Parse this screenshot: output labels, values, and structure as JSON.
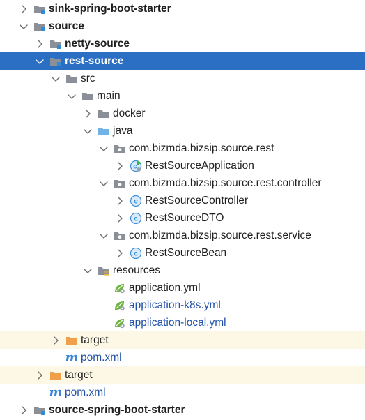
{
  "tree": {
    "items": [
      {
        "label": "sink-spring-boot-starter",
        "depth": 0,
        "state": "collapsed",
        "icon": "module-folder-icon",
        "bold": true
      },
      {
        "label": "source",
        "depth": 0,
        "state": "expanded",
        "icon": "module-folder-icon",
        "bold": true
      },
      {
        "label": "netty-source",
        "depth": 1,
        "state": "collapsed",
        "icon": "module-folder-icon",
        "bold": true
      },
      {
        "label": "rest-source",
        "depth": 1,
        "state": "expanded",
        "icon": "module-folder-icon",
        "bold": true,
        "selected": true
      },
      {
        "label": "src",
        "depth": 2,
        "state": "expanded",
        "icon": "folder-icon"
      },
      {
        "label": "main",
        "depth": 3,
        "state": "expanded",
        "icon": "folder-icon"
      },
      {
        "label": "docker",
        "depth": 4,
        "state": "collapsed",
        "icon": "folder-icon"
      },
      {
        "label": "java",
        "depth": 4,
        "state": "expanded",
        "icon": "source-root-folder-icon"
      },
      {
        "label": "com.bizmda.bizsip.source.rest",
        "depth": 5,
        "state": "expanded",
        "icon": "package-icon"
      },
      {
        "label": "RestSourceApplication",
        "depth": 6,
        "state": "collapsed",
        "icon": "spring-boot-class-icon"
      },
      {
        "label": "com.bizmda.bizsip.source.rest.controller",
        "depth": 5,
        "state": "expanded",
        "icon": "package-icon"
      },
      {
        "label": "RestSourceController",
        "depth": 6,
        "state": "collapsed",
        "icon": "class-icon"
      },
      {
        "label": "RestSourceDTO",
        "depth": 6,
        "state": "collapsed",
        "icon": "class-icon"
      },
      {
        "label": "com.bizmda.bizsip.source.rest.service",
        "depth": 5,
        "state": "expanded",
        "icon": "package-icon"
      },
      {
        "label": "RestSourceBean",
        "depth": 6,
        "state": "collapsed",
        "icon": "class-icon"
      },
      {
        "label": "resources",
        "depth": 4,
        "state": "expanded",
        "icon": "resources-folder-icon"
      },
      {
        "label": "application.yml",
        "depth": 5,
        "state": "leaf",
        "icon": "spring-config-icon"
      },
      {
        "label": "application-k8s.yml",
        "depth": 5,
        "state": "leaf",
        "icon": "spring-config-icon",
        "link": true
      },
      {
        "label": "application-local.yml",
        "depth": 5,
        "state": "leaf",
        "icon": "spring-config-icon",
        "link": true
      },
      {
        "label": "target",
        "depth": 2,
        "state": "collapsed",
        "icon": "excluded-folder-icon",
        "excluded": true
      },
      {
        "label": "pom.xml",
        "depth": 2,
        "state": "leaf",
        "icon": "maven-icon",
        "link": true
      },
      {
        "label": "target",
        "depth": 1,
        "state": "collapsed",
        "icon": "excluded-folder-icon",
        "excluded": true
      },
      {
        "label": "pom.xml",
        "depth": 1,
        "state": "leaf",
        "icon": "maven-icon",
        "link": true
      },
      {
        "label": "source-spring-boot-starter",
        "depth": 0,
        "state": "collapsed",
        "icon": "module-folder-icon",
        "bold": true
      }
    ]
  },
  "colors": {
    "selection": "#2a6fc4",
    "excluded_row": "#fdf8e6",
    "folder": "#8a8f98",
    "source_folder": "#6fb3e8",
    "excluded_folder": "#f0a04b",
    "class_icon": "#3d8fd6",
    "link_text": "#1f4fa8"
  }
}
